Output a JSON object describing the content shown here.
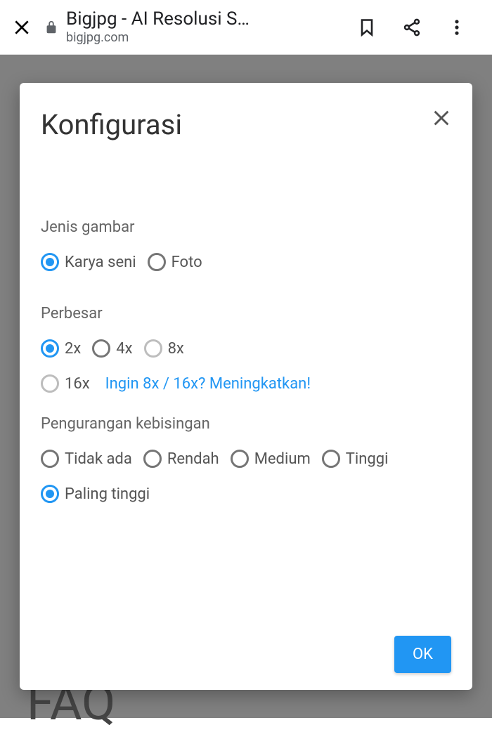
{
  "browser": {
    "title": "Bigjpg - AI Resolusi S…",
    "url": "bigjpg.com"
  },
  "background": {
    "faq": "FAQ"
  },
  "dialog": {
    "title": "Konfigurasi",
    "sections": {
      "image_type": {
        "label": "Jenis gambar",
        "options": {
          "artwork": "Karya seni",
          "photo": "Foto"
        }
      },
      "upscale": {
        "label": "Perbesar",
        "options": {
          "x2": "2x",
          "x4": "4x",
          "x8": "8x",
          "x16": "16x"
        },
        "upgrade_link": "Ingin 8x / 16x? Meningkatkan!"
      },
      "noise": {
        "label": "Pengurangan kebisingan",
        "options": {
          "none": "Tidak ada",
          "low": "Rendah",
          "medium": "Medium",
          "high": "Tinggi",
          "highest": "Paling tinggi"
        }
      }
    },
    "ok": "OK"
  }
}
